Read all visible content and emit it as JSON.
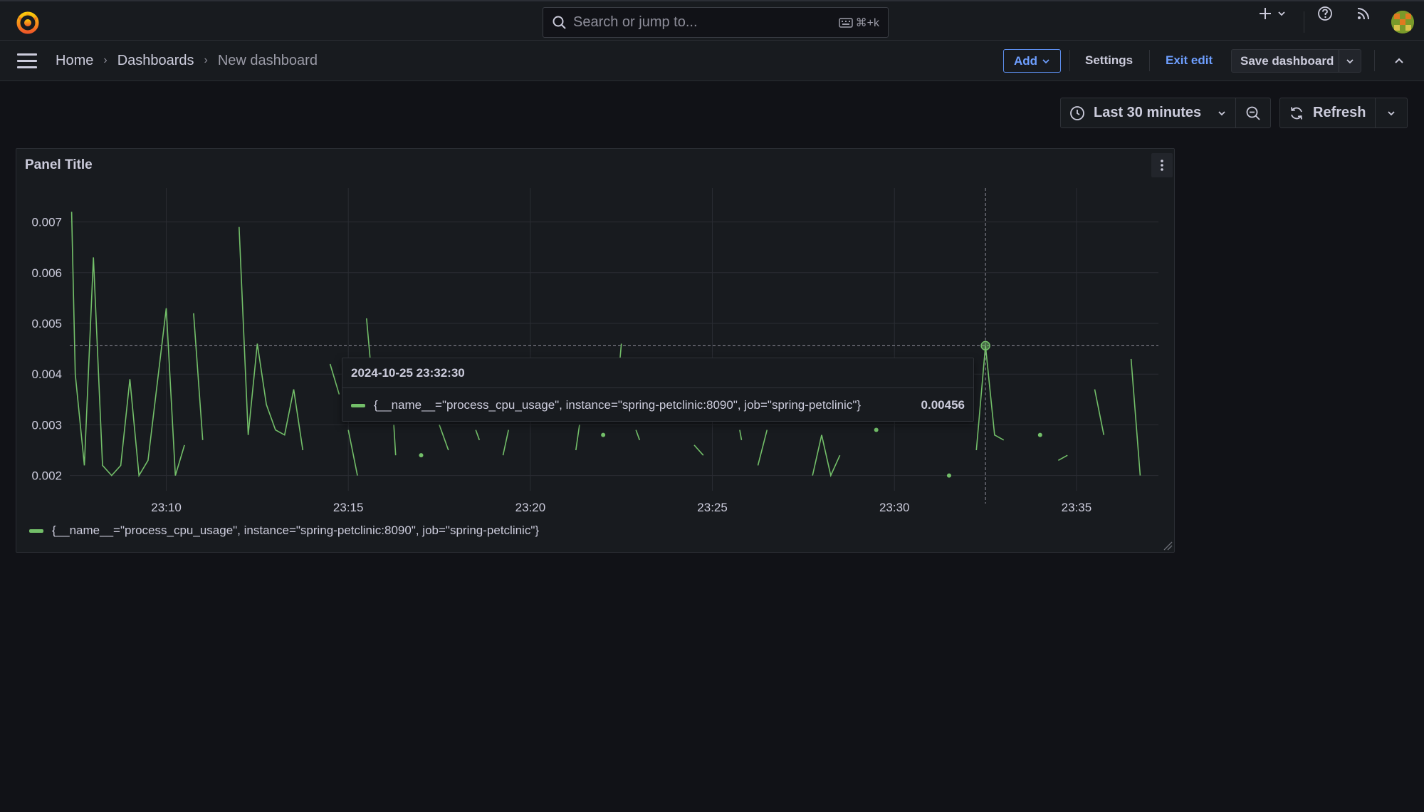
{
  "topbar": {
    "search_placeholder": "Search or jump to...",
    "search_shortcut": "⌘+k",
    "icons": [
      "grafana-logo-icon",
      "search-icon",
      "keyboard-icon",
      "plus-icon",
      "chevron-down-icon",
      "help-icon",
      "rss-icon",
      "avatar"
    ]
  },
  "breadcrumb": {
    "items": [
      "Home",
      "Dashboards",
      "New dashboard"
    ]
  },
  "toolbar": {
    "add_label": "Add",
    "settings_label": "Settings",
    "exit_edit_label": "Exit edit",
    "save_label": "Save dashboard"
  },
  "timepicker": {
    "range_label": "Last 30 minutes",
    "refresh_label": "Refresh"
  },
  "panel": {
    "title": "Panel Title"
  },
  "tooltip": {
    "timestamp": "2024-10-25 23:32:30",
    "series": "{__name__=\"process_cpu_usage\", instance=\"spring-petclinic:8090\", job=\"spring-petclinic\"}",
    "value": "0.00456"
  },
  "colors": {
    "series": "#73bf69",
    "accent": "#6e9fff",
    "background": "#111217",
    "panel": "#181b1f"
  },
  "chart_data": {
    "type": "line",
    "title": "Panel Title",
    "xlabel": "",
    "ylabel": "",
    "x_ticks": [
      "23:10",
      "23:15",
      "23:20",
      "23:25",
      "23:30",
      "23:35"
    ],
    "y_ticks": [
      "0.002",
      "0.003",
      "0.004",
      "0.005",
      "0.006",
      "0.007"
    ],
    "ylim": [
      0.0017,
      0.0075
    ],
    "xlim_minutes": [
      7.35,
      37.25
    ],
    "x_tick_minutes": [
      10,
      15,
      20,
      25,
      30,
      35
    ],
    "grid": true,
    "legend_placement": "bottom-left",
    "series": [
      {
        "name": "{__name__=\"process_cpu_usage\", instance=\"spring-petclinic:8090\", job=\"spring-petclinic\"}",
        "segments": [
          [
            [
              7.4,
              0.0072
            ],
            [
              7.5,
              0.004
            ],
            [
              7.75,
              0.0022
            ],
            [
              8.0,
              0.0063
            ],
            [
              8.25,
              0.0022
            ],
            [
              8.5,
              0.002
            ],
            [
              8.75,
              0.0022
            ],
            [
              9.0,
              0.0039
            ],
            [
              9.25,
              0.002
            ],
            [
              9.5,
              0.0023
            ],
            [
              10.0,
              0.0053
            ],
            [
              10.25,
              0.002
            ],
            [
              10.5,
              0.0026
            ]
          ],
          [
            [
              10.75,
              0.0052
            ],
            [
              11.0,
              0.0027
            ]
          ],
          [
            [
              12.0,
              0.0069
            ],
            [
              12.25,
              0.0028
            ],
            [
              12.5,
              0.0046
            ],
            [
              12.75,
              0.0034
            ],
            [
              13.0,
              0.0029
            ],
            [
              13.25,
              0.0028
            ],
            [
              13.5,
              0.0037
            ],
            [
              13.75,
              0.0025
            ]
          ],
          [
            [
              14.5,
              0.0042
            ],
            [
              14.75,
              0.0036
            ]
          ],
          [
            [
              15.0,
              0.0029
            ],
            [
              15.25,
              0.002
            ]
          ],
          [
            [
              15.5,
              0.0051
            ],
            [
              15.6,
              0.0043
            ]
          ],
          [
            [
              16.25,
              0.003
            ],
            [
              16.3,
              0.0024
            ]
          ],
          [
            [
              17.5,
              0.003
            ],
            [
              17.75,
              0.0025
            ]
          ],
          [
            [
              18.5,
              0.0029
            ],
            [
              18.6,
              0.0027
            ]
          ],
          [
            [
              19.25,
              0.0024
            ],
            [
              19.4,
              0.0029
            ]
          ],
          [
            [
              21.25,
              0.0025
            ],
            [
              21.35,
              0.003
            ]
          ],
          [
            [
              22.45,
              0.0042
            ],
            [
              22.5,
              0.0046
            ]
          ],
          [
            [
              22.9,
              0.0029
            ],
            [
              23.0,
              0.0027
            ]
          ],
          [
            [
              24.5,
              0.0026
            ],
            [
              24.75,
              0.0024
            ]
          ],
          [
            [
              25.75,
              0.0029
            ],
            [
              25.8,
              0.0027
            ]
          ],
          [
            [
              26.25,
              0.0022
            ],
            [
              26.5,
              0.0029
            ]
          ],
          [
            [
              27.75,
              0.002
            ],
            [
              28.0,
              0.0028
            ],
            [
              28.25,
              0.002
            ],
            [
              28.5,
              0.0024
            ]
          ],
          [
            [
              32.25,
              0.0025
            ],
            [
              32.5,
              0.00456
            ],
            [
              32.75,
              0.0028
            ],
            [
              33.0,
              0.0027
            ]
          ],
          [
            [
              34.5,
              0.0023
            ],
            [
              34.75,
              0.0024
            ]
          ],
          [
            [
              35.5,
              0.0037
            ],
            [
              35.75,
              0.0028
            ]
          ],
          [
            [
              36.5,
              0.0043
            ],
            [
              36.75,
              0.002
            ]
          ]
        ],
        "points": [
          [
            17.0,
            0.0024
          ],
          [
            22.0,
            0.0028
          ],
          [
            31.5,
            0.002
          ],
          [
            34.0,
            0.0028
          ],
          [
            29.5,
            0.0029
          ]
        ]
      }
    ],
    "hover": {
      "x": 32.5,
      "y": 0.00456
    }
  }
}
